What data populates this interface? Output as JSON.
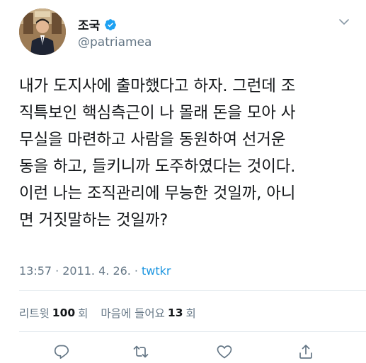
{
  "author": {
    "display_name": "조국",
    "handle": "@patriamea"
  },
  "tweet": {
    "text": "내가 도지사에 출마했다고 하자. 그런데 조\n직특보인 핵심측근이 나 몰래 돈을 모아 사\n무실을 마련하고 사람을 동원하여 선거운\n동을 하고, 들키니까 도주하였다는 것이다.\n이런 나는 조직관리에 무능한 것일까, 아니\n면 거짓말하는 것일까?"
  },
  "meta": {
    "time": "13:57",
    "sep1": "·",
    "date": "2011. 4. 26.",
    "sep2": "·",
    "source": "twtkr"
  },
  "stats": {
    "retweet_label": "리트윗",
    "retweet_count": "100",
    "retweet_unit": "회",
    "like_label": "마음에 들어요",
    "like_count": "13",
    "like_unit": "회"
  },
  "icons": {
    "verified": "verified-badge-icon",
    "menu": "chevron-down-icon",
    "reply": "reply-icon",
    "retweet": "retweet-icon",
    "like": "heart-icon",
    "share": "share-icon"
  },
  "colors": {
    "text": "#14171a",
    "secondary": "#657786",
    "accent": "#1da1f2",
    "link": "#1b95e0",
    "divider": "#e6ecf0"
  }
}
